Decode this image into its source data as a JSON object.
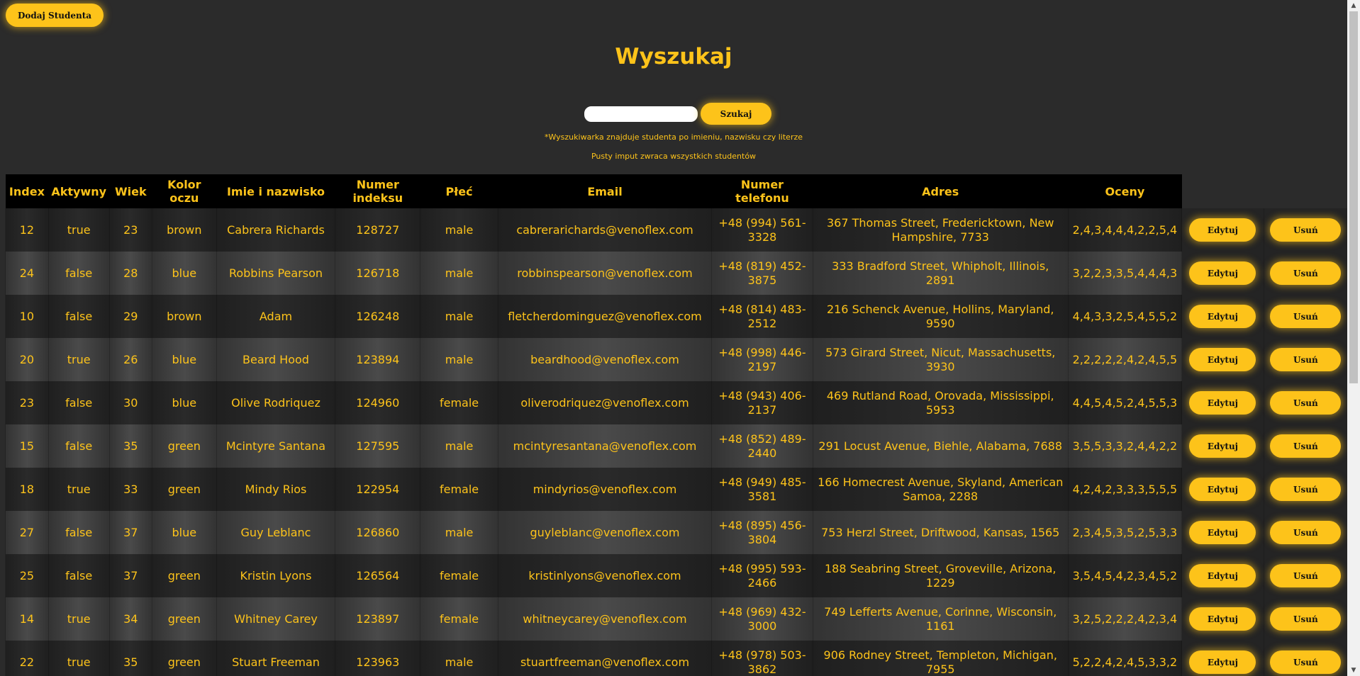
{
  "header": {
    "add_student_label": "Dodaj Studenta",
    "title": "Wyszukaj"
  },
  "search": {
    "value": "",
    "placeholder": "",
    "button_label": "Szukaj",
    "hint_line1": "*Wyszukiwarka znajduje studenta po imieniu, nazwisku czy literze",
    "hint_line2": "Pusty imput zwraca wszystkich studentów"
  },
  "table": {
    "columns": [
      "Index",
      "Aktywny",
      "Wiek",
      "Kolor oczu",
      "Imie i nazwisko",
      "Numer indeksu",
      "Płeć",
      "Email",
      "Numer telefonu",
      "Adres",
      "Oceny"
    ],
    "edit_label": "Edytuj",
    "delete_label": "Usuń",
    "rows": [
      [
        "12",
        "true",
        "23",
        "brown",
        "Cabrera Richards",
        "128727",
        "male",
        "cabrerarichards@venoflex.com",
        "+48 (994) 561-3328",
        "367 Thomas Street, Fredericktown, New Hampshire, 7733",
        "2,4,3,4,4,4,2,2,5,4"
      ],
      [
        "24",
        "false",
        "28",
        "blue",
        "Robbins Pearson",
        "126718",
        "male",
        "robbinspearson@venoflex.com",
        "+48 (819) 452-3875",
        "333 Bradford Street, Whipholt, Illinois, 2891",
        "3,2,2,3,3,5,4,4,4,3"
      ],
      [
        "10",
        "false",
        "29",
        "brown",
        "Adam",
        "126248",
        "male",
        "fletcherdominguez@venoflex.com",
        "+48 (814) 483-2512",
        "216 Schenck Avenue, Hollins, Maryland, 9590",
        "4,4,3,3,2,5,4,5,5,2"
      ],
      [
        "20",
        "true",
        "26",
        "blue",
        "Beard Hood",
        "123894",
        "male",
        "beardhood@venoflex.com",
        "+48 (998) 446-2197",
        "573 Girard Street, Nicut, Massachusetts, 3930",
        "2,2,2,2,2,4,2,4,5,5"
      ],
      [
        "23",
        "false",
        "30",
        "blue",
        "Olive Rodriquez",
        "124960",
        "female",
        "oliverodriquez@venoflex.com",
        "+48 (943) 406-2137",
        "469 Rutland Road, Orovada, Mississippi, 5953",
        "4,4,5,4,5,2,4,5,5,3"
      ],
      [
        "15",
        "false",
        "35",
        "green",
        "Mcintyre Santana",
        "127595",
        "male",
        "mcintyresantana@venoflex.com",
        "+48 (852) 489-2440",
        "291 Locust Avenue, Biehle, Alabama, 7688",
        "3,5,5,3,3,2,4,4,2,2"
      ],
      [
        "18",
        "true",
        "33",
        "green",
        "Mindy Rios",
        "122954",
        "female",
        "mindyrios@venoflex.com",
        "+48 (949) 485-3581",
        "166 Homecrest Avenue, Skyland, American Samoa, 2288",
        "4,2,4,2,3,3,3,5,5,5"
      ],
      [
        "27",
        "false",
        "37",
        "blue",
        "Guy Leblanc",
        "126860",
        "male",
        "guyleblanc@venoflex.com",
        "+48 (895) 456-3804",
        "753 Herzl Street, Driftwood, Kansas, 1565",
        "2,3,4,5,3,5,2,5,3,3"
      ],
      [
        "25",
        "false",
        "37",
        "green",
        "Kristin Lyons",
        "126564",
        "female",
        "kristinlyons@venoflex.com",
        "+48 (995) 593-2466",
        "188 Seabring Street, Groveville, Arizona, 1229",
        "3,5,4,5,4,2,3,4,5,2"
      ],
      [
        "14",
        "true",
        "34",
        "green",
        "Whitney Carey",
        "123897",
        "female",
        "whitneycarey@venoflex.com",
        "+48 (969) 432-3000",
        "749 Lefferts Avenue, Corinne, Wisconsin, 1161",
        "3,2,5,2,2,2,4,2,3,4"
      ],
      [
        "22",
        "true",
        "35",
        "green",
        "Stuart Freeman",
        "123963",
        "male",
        "stuartfreeman@venoflex.com",
        "+48 (978) 503-3862",
        "906 Rodney Street, Templeton, Michigan, 7955",
        "5,2,2,4,2,4,5,3,3,2"
      ]
    ]
  },
  "colors": {
    "accent": "#fdc31a",
    "background": "#2b2b2b",
    "header_bg": "#000000"
  },
  "icons": {
    "scroll_up": "triangle-up-icon",
    "scroll_down": "triangle-down-icon"
  }
}
